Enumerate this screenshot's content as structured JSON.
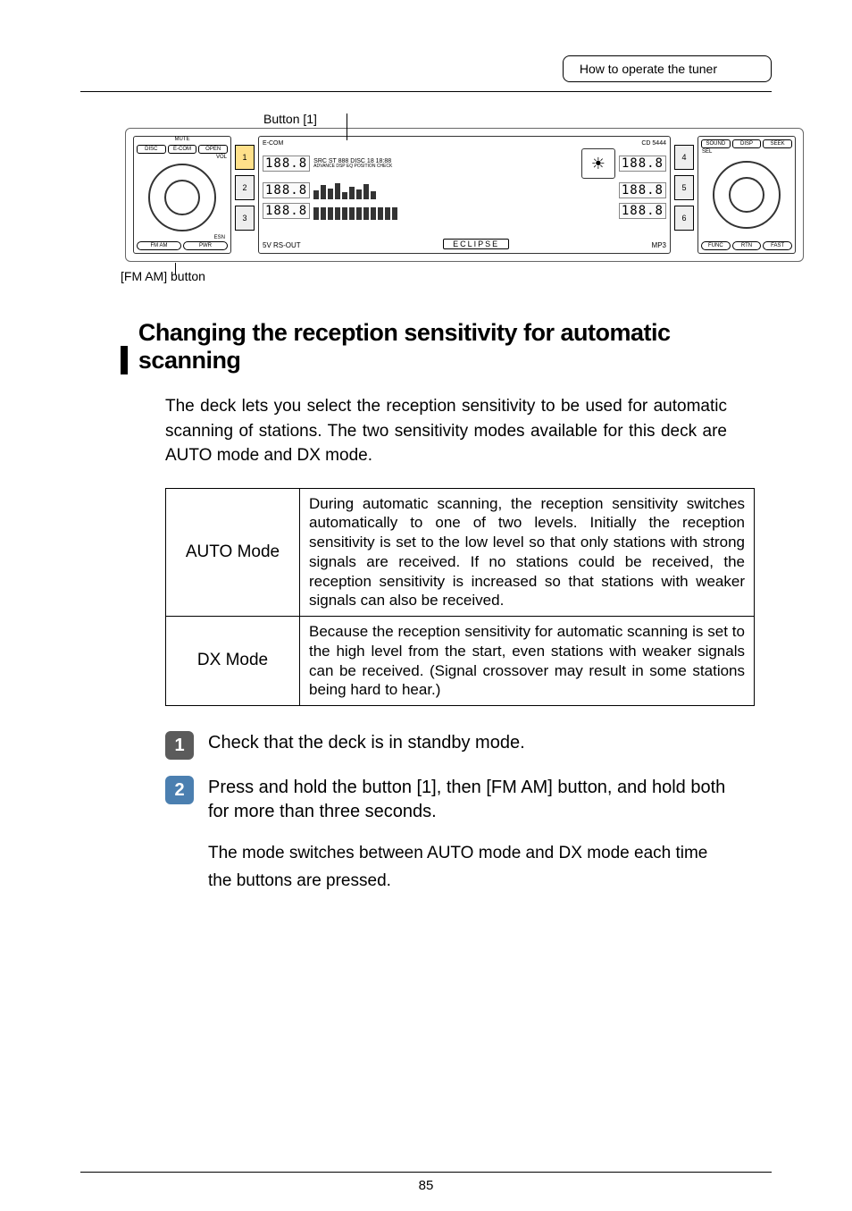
{
  "header": {
    "right_box": "How to operate the tuner"
  },
  "diagram": {
    "button1_label": "Button [1]",
    "fmam_label": "[FM AM] button",
    "left_panel": {
      "top_buttons": [
        "DISC",
        "E-COM",
        "OPEN"
      ],
      "mute_label": "MUTE",
      "vol_label": "VOL",
      "esn_label": "ESN",
      "bottom_buttons": [
        "FM AM",
        "PWR"
      ]
    },
    "numcol_left": [
      "1",
      "2",
      "3"
    ],
    "mid_panel": {
      "top_left": "E-COM",
      "top_right": "CD 5444",
      "row1_a": "188.8",
      "row1_b": "SRC ST 888 DISC 18 18:88",
      "row1_tags": "ADVANCE DSP EQ POSITION CHECK",
      "row1_right": "188.8",
      "row2_a": "188.8",
      "row2_right": "188.8",
      "row3_a": "188.8",
      "row3_right": "188.8",
      "bottom_left": "5V RS-OUT",
      "bottom_mid": "ECLIPSE",
      "bottom_right": "MP3"
    },
    "numcol_right": [
      "4",
      "5",
      "6"
    ],
    "right_panel": {
      "top_buttons": [
        "SOUND",
        "DISP",
        "SEEK"
      ],
      "sel_label": "SEL",
      "bottom_buttons": [
        "FUNC",
        "RTN",
        "FAST"
      ]
    }
  },
  "section": {
    "title": "Changing the reception sensitivity for automatic scanning",
    "paragraph": "The deck lets you select the reception sensitivity to be used for automatic scanning of stations. The two sensitivity modes available for this deck are AUTO mode and DX mode."
  },
  "modes_table": {
    "rows": [
      {
        "name": "AUTO Mode",
        "desc": "During automatic scanning, the reception sensitivity switches automatically to one of two levels. Initially the reception sensitivity is set to the low level so that only stations with strong signals are received. If no stations could be received, the reception sensitivity is increased so that stations with weaker signals can also be received."
      },
      {
        "name": "DX Mode",
        "desc": "Because the reception sensitivity for automatic scanning is set to the high level from the start, even stations with weaker signals can be received. (Signal crossover may result in some stations being hard to hear.)"
      }
    ]
  },
  "steps": [
    {
      "num": "1",
      "text": "Check that the deck is in standby mode."
    },
    {
      "num": "2",
      "text": "Press and hold the button [1], then [FM AM] button, and hold both for more than three seconds."
    }
  ],
  "after_steps": "The mode switches between AUTO mode and DX mode each time the buttons are pressed.",
  "page_number": "85"
}
